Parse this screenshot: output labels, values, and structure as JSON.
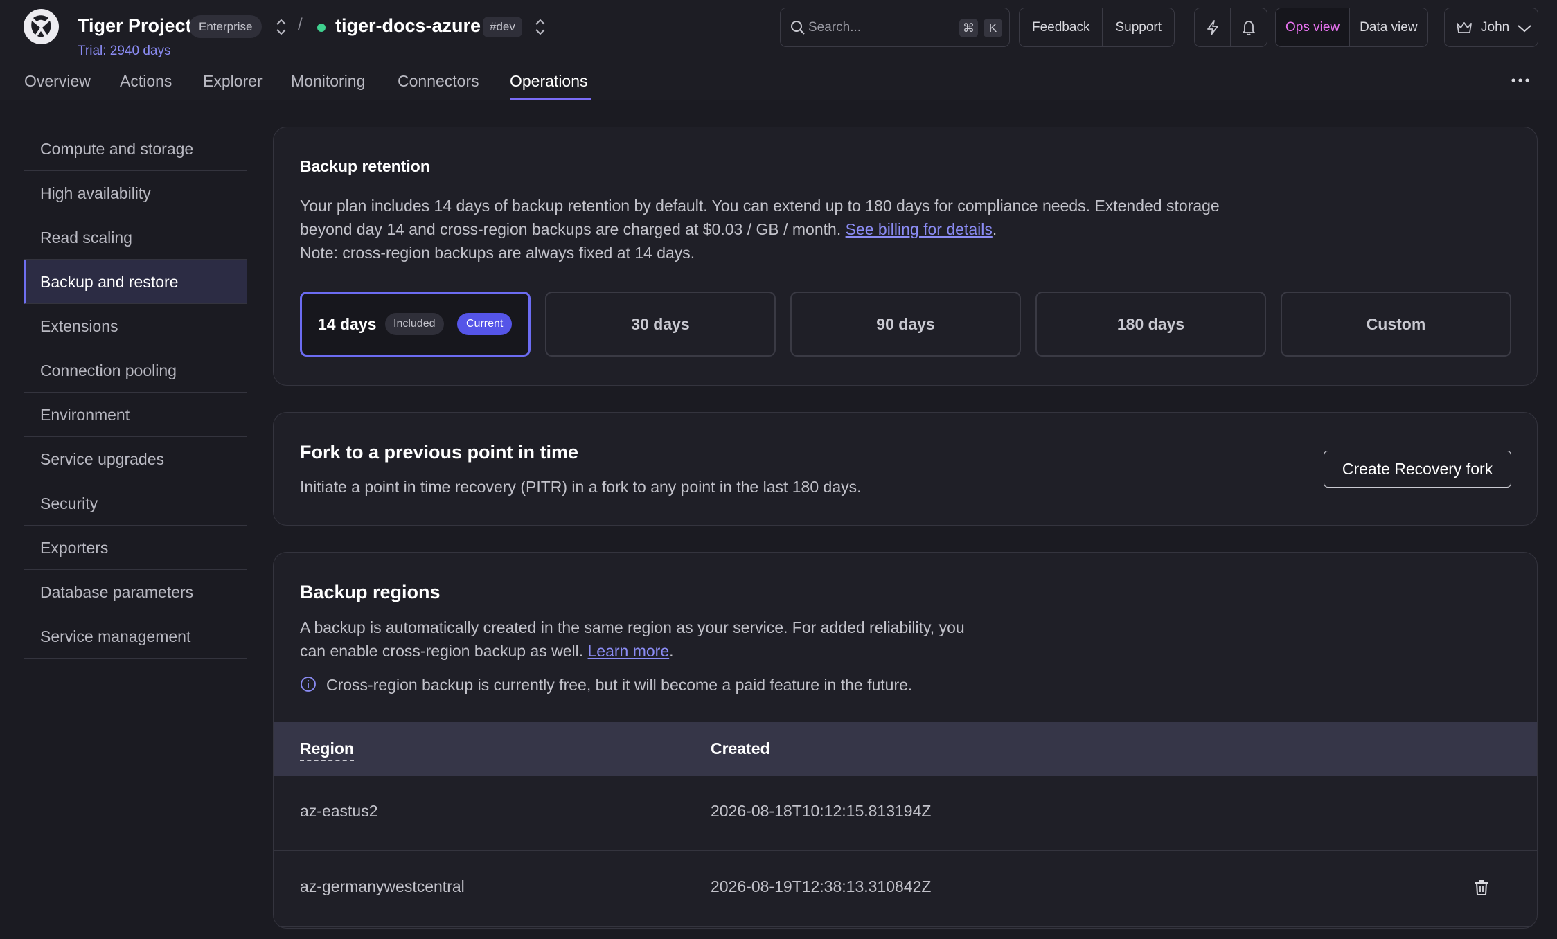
{
  "header": {
    "project_name": "Tiger Project",
    "plan_badge": "Enterprise",
    "trial": "Trial: 2940 days",
    "separator": "/",
    "service_name": "tiger-docs-azure",
    "env_tag": "#dev",
    "status_color": "#3fd18f",
    "search": {
      "placeholder": "Search...",
      "shortcut_mod": "⌘",
      "shortcut_key": "K"
    },
    "feedback_label": "Feedback",
    "support_label": "Support",
    "ops_view_label": "Ops view",
    "data_view_label": "Data view",
    "user_name": "John"
  },
  "tabs": [
    "Overview",
    "Actions",
    "Explorer",
    "Monitoring",
    "Connectors",
    "Operations"
  ],
  "active_tab": "Operations",
  "sidebar": {
    "items": [
      "Compute and storage",
      "High availability",
      "Read scaling",
      "Backup and restore",
      "Extensions",
      "Connection pooling",
      "Environment",
      "Service upgrades",
      "Security",
      "Exporters",
      "Database parameters",
      "Service management"
    ],
    "active": "Backup and restore"
  },
  "retention": {
    "title": "Backup retention",
    "text_line1": "Your plan includes 14 days of backup retention by default. You can extend up to 180 days for compliance needs. Extended storage",
    "text_line2": "beyond day 14 and cross-region backups are charged at $0.03 / GB / month.",
    "link": "See billing for details",
    "text_after_link": ".",
    "note": "Note: cross-region backups are always fixed at 14 days.",
    "options": [
      "14 days",
      "30 days",
      "90 days",
      "180 days",
      "Custom"
    ],
    "selected_included_label": "Included",
    "selected_current_label": "Current"
  },
  "fork": {
    "title": "Fork to a previous point in time",
    "text": "Initiate a point in time recovery (PITR) in a fork to any point in the last 180 days.",
    "button": "Create Recovery fork"
  },
  "regions": {
    "title": "Backup regions",
    "text_line1": "A backup is automatically created in the same region as your service. For added reliability, you",
    "text_line2": "can enable cross-region backup as well.",
    "link": "Learn more",
    "text_after_link": ".",
    "info": "Cross-region backup is currently free, but it will become a paid feature in the future.",
    "columns": {
      "region": "Region",
      "created": "Created"
    },
    "rows": [
      {
        "region": "az-eastus2",
        "created": "2026-08-18T10:12:15.813194Z",
        "deletable": false
      },
      {
        "region": "az-germanywestcentral",
        "created": "2026-08-19T12:38:13.310842Z",
        "deletable": true
      }
    ]
  },
  "colors": {
    "accent": "#6c6cf2",
    "link": "#8b8cf4",
    "ops_view_text": "#e873f0",
    "background": "#1b1b22"
  }
}
